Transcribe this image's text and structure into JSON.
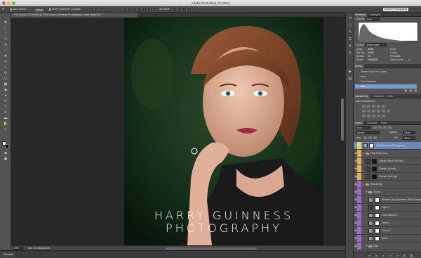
{
  "app": {
    "title": "Adobe Photoshop CC 2014"
  },
  "options_bar": {
    "auto_select_label": "Auto-Select:",
    "auto_select_mode": "Group",
    "show_transform_label": "Show Transform Controls",
    "mode_3d_label": "3D Mode:",
    "workspace": "Custom Photography"
  },
  "document": {
    "tab_title": "IR-Sonny-223-Edit.tif @ 25% (Harry Guinness Photography, Layer Mask/16) *",
    "zoom": "25%",
    "doc_info": "Doc: 90.7M/380.0M",
    "watermark_line1": "HARRY GUINNESS",
    "watermark_line2": "PHOTOGRAPHY"
  },
  "timeline": {
    "label": "Timeline"
  },
  "histogram": {
    "tabs": [
      "Histogram",
      "Navigator"
    ],
    "channel_label": "Channel:",
    "channel_value": "RGB",
    "source_label": "Source:",
    "source_value": "Entire Image",
    "stats": [
      {
        "label": "Mean:",
        "value": "38.26"
      },
      {
        "label": "Std Dev:",
        "value": "44.59"
      },
      {
        "label": "Median:",
        "value": "23"
      },
      {
        "label": "Pixels:",
        "value": "11664000"
      }
    ],
    "stats_right": [
      {
        "label": "Level:",
        "value": ""
      },
      {
        "label": "Count:",
        "value": ""
      },
      {
        "label": "Percentile:",
        "value": ""
      },
      {
        "label": "Cache Level:",
        "value": "4"
      }
    ]
  },
  "history": {
    "tab": "History",
    "items": [
      "Create Group from Layers",
      "Move",
      "Free Transform",
      "Move"
    ]
  },
  "adjustments": {
    "tabs": [
      "Adjustments",
      "Swatches",
      "Color"
    ],
    "heading": "Add an adjustment"
  },
  "layers": {
    "tabs": [
      "Layers",
      "Channels",
      "Paths"
    ],
    "filter_kind": "Kind",
    "blend_mode": "Normal",
    "opacity_label": "Opacity:",
    "opacity_value": "100%",
    "lock_label": "Lock:",
    "fill_label": "Fill:",
    "fill_value": "100%",
    "items": [
      {
        "name": "Harry Guinness Photography",
        "color": "#e8d068",
        "kind": "text"
      },
      {
        "name": "Final Sharpening",
        "color": "#e8b050",
        "kind": "group"
      },
      {
        "name": "Sharpen More Soft Light",
        "color": "#e8b050",
        "kind": "layer"
      },
      {
        "name": "Sharpen Overlay",
        "color": "#e8b050",
        "kind": "layer"
      },
      {
        "name": "Sharpen Soft Light",
        "color": "#e8b050",
        "kind": "layer"
      },
      {
        "name": "Retouching",
        "color": "#9b6ac8",
        "kind": "group"
      },
      {
        "name": "Toning",
        "color": "#9b6ac8",
        "kind": "group"
      },
      {
        "name": "Gradient Map Adjustment (Burnt Orange)",
        "color": "#9b6ac8",
        "kind": "adj"
      },
      {
        "name": "Layer 1",
        "color": "#9b6ac8",
        "kind": "layer"
      },
      {
        "name": "Color Balance 1",
        "color": "#9b6ac8",
        "kind": "adj"
      },
      {
        "name": "Levels 1",
        "color": "#9b6ac8",
        "kind": "adj"
      },
      {
        "name": "Curves 1",
        "color": "#9b6ac8",
        "kind": "adj"
      },
      {
        "name": "Blend",
        "color": "#9b6ac8",
        "kind": "adj"
      },
      {
        "name": "Eyes",
        "color": "#9b6ac8",
        "kind": "group"
      }
    ]
  }
}
